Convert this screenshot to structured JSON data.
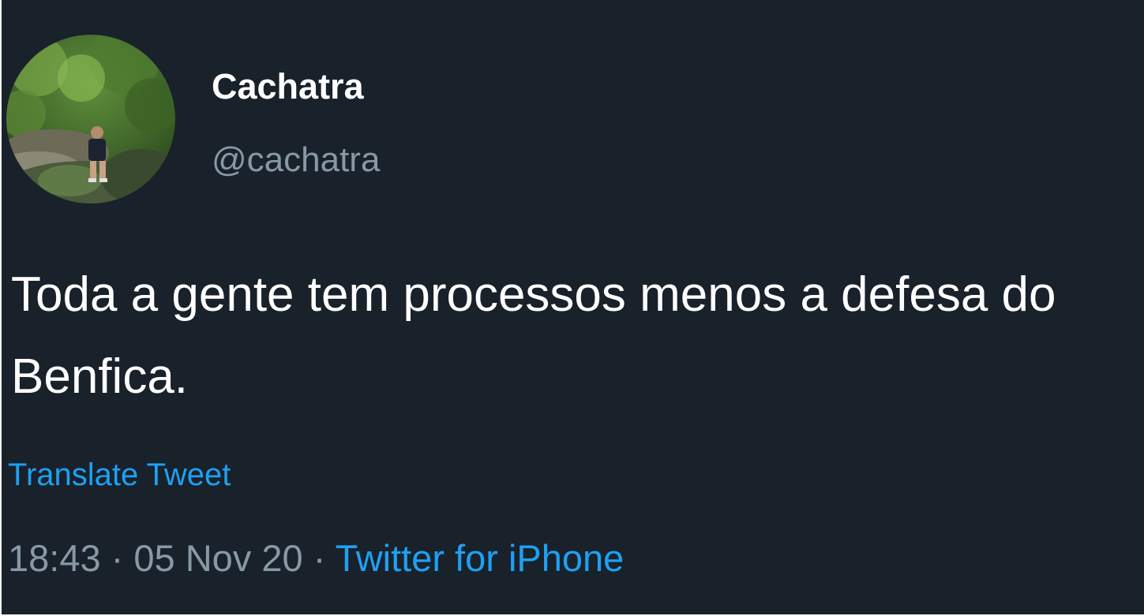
{
  "author": {
    "display_name": "Cachatra",
    "handle": "@cachatra",
    "avatar_icon": "profile-photo-forest-person"
  },
  "tweet": {
    "text": "Toda a gente tem processos menos a defesa do Benfica.",
    "translate_label": "Translate Tweet",
    "time": "18:43",
    "separator": " · ",
    "date": "05 Nov 20",
    "source": "Twitter for iPhone"
  },
  "colors": {
    "background": "#19212b",
    "text": "#ffffff",
    "secondary": "#8899a6",
    "accent": "#1da1f2"
  }
}
